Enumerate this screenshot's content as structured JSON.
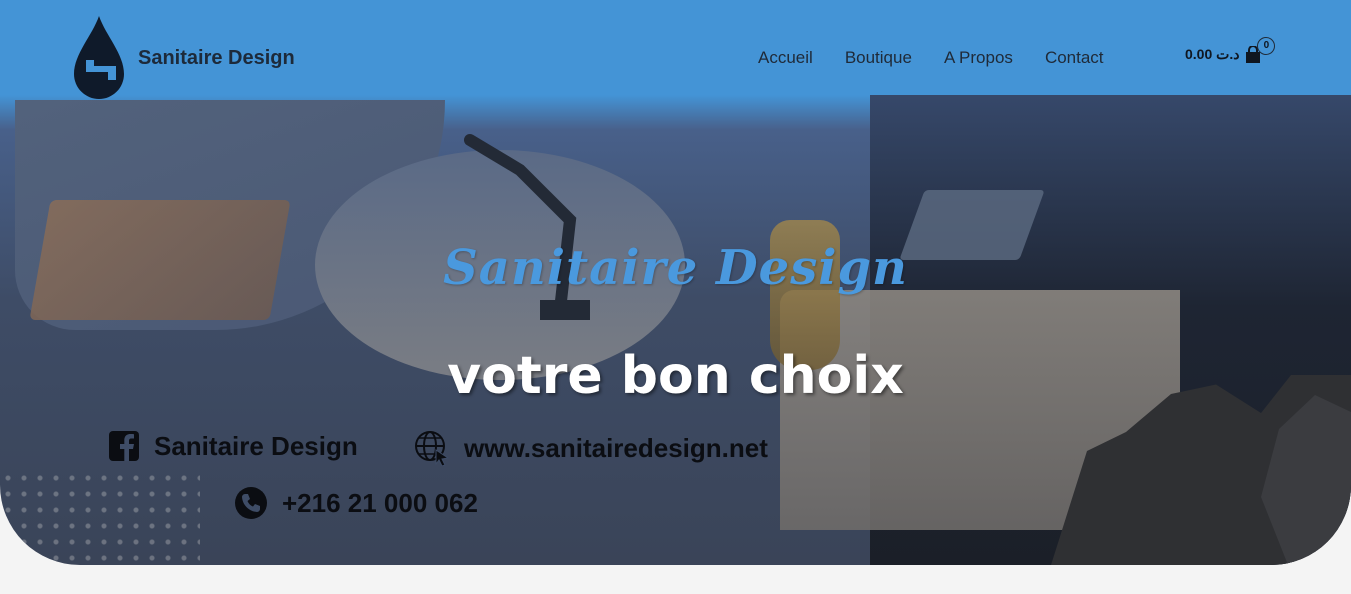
{
  "header": {
    "brand": "Sanitaire Design",
    "nav": [
      {
        "label": "Accueil"
      },
      {
        "label": "Boutique"
      },
      {
        "label": "A Propos"
      },
      {
        "label": "Contact"
      }
    ],
    "cart": {
      "amount": "د.ت 0.00",
      "count": "0"
    }
  },
  "hero": {
    "title": "Sanitaire Design",
    "subtitle": "votre bon choix",
    "contacts": {
      "facebook": "Sanitaire Design",
      "website": "www.sanitairedesign.net",
      "phone": "+216 21 000 062"
    }
  },
  "colors": {
    "header_blue": "#4494d6",
    "title_blue": "#4a99de",
    "page_bg": "#f4f4f4"
  },
  "icons": [
    "water-drop-faucet-logo-icon",
    "shopping-bag-icon",
    "facebook-icon",
    "globe-cursor-icon",
    "phone-icon"
  ]
}
